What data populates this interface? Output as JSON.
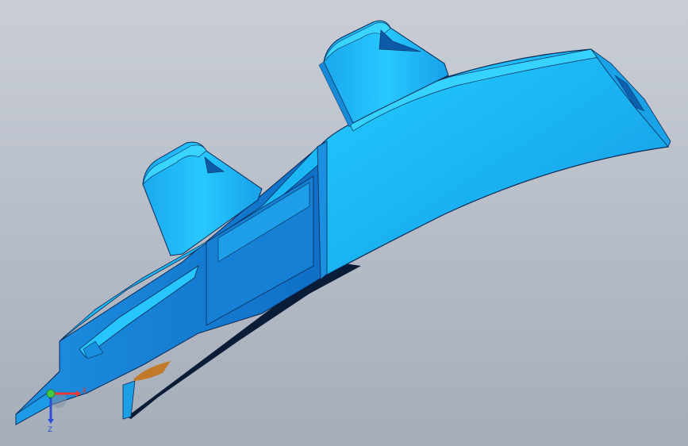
{
  "window": {
    "background_top": "#c9ced6",
    "background_bottom": "#a5adba"
  },
  "model": {
    "fill_light": "#1cc6ff",
    "fill_mid": "#1aa9ec",
    "fill_dark": "#1577cc",
    "edge_color": "#0b2a55",
    "shadow_color": "#0a1f3a",
    "accent_part_color": "#c07a2a"
  },
  "triad": {
    "x_label": "X",
    "z_label": "Z",
    "x_color": "#e53935",
    "y_color": "#43c943",
    "z_color": "#2b4fd6",
    "x_icon": "x-axis-arrow-icon",
    "z_icon": "z-axis-arrow-icon",
    "origin_icon": "origin-sphere-icon"
  }
}
